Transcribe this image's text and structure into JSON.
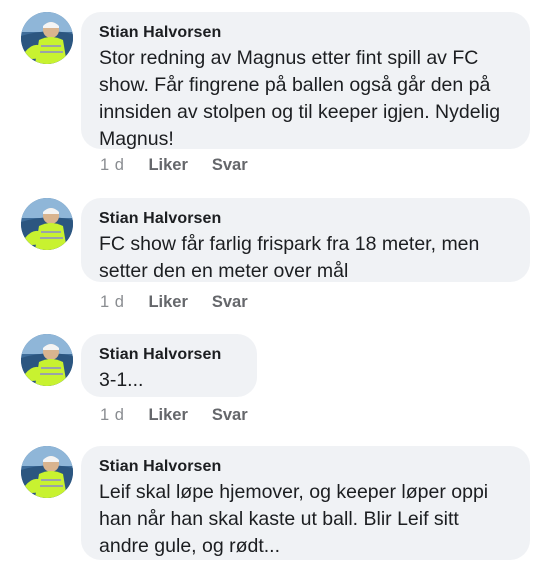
{
  "comments": [
    {
      "author": "Stian Halvorsen",
      "text": "Stor redning av Magnus etter fint spill av FC show. Får fingrene på ballen også går den på innsiden av stolpen og til keeper igjen. Nydelig Magnus!",
      "time": "1 d",
      "like_label": "Liker",
      "reply_label": "Svar"
    },
    {
      "author": "Stian Halvorsen",
      "text": "FC show får farlig frispark fra 18 meter, men setter den en meter over mål",
      "time": "1 d",
      "like_label": "Liker",
      "reply_label": "Svar"
    },
    {
      "author": "Stian Halvorsen",
      "text": "3-1...",
      "time": "1 d",
      "like_label": "Liker",
      "reply_label": "Svar"
    },
    {
      "author": "Stian Halvorsen",
      "text": "Leif skal løpe hjemover, og keeper løper oppi han når han skal kaste ut ball. Blir Leif sitt andre gule, og rødt...",
      "time": "",
      "like_label": "",
      "reply_label": ""
    }
  ],
  "colors": {
    "bubble_bg": "#f0f2f5",
    "text": "#1c1e21",
    "meta": "#65676b",
    "avatar_vest": "#c8f230"
  },
  "icons": {
    "avatar": "profile-photo-avatar"
  }
}
